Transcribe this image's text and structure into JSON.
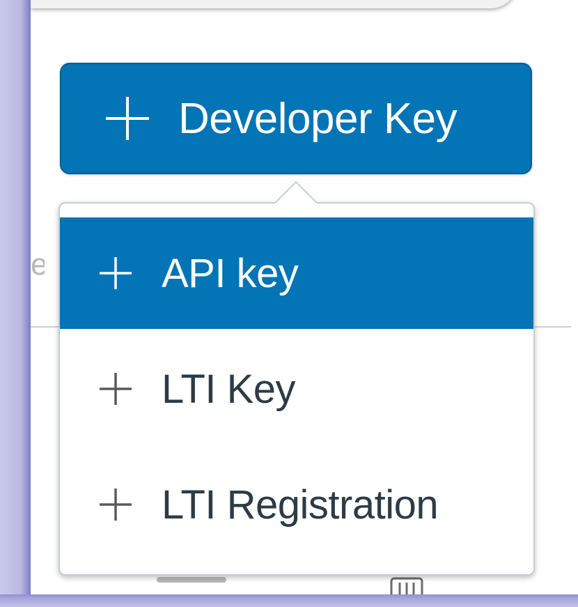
{
  "button": {
    "label": "Developer Key",
    "icon": "plus-icon",
    "color": "#0374b5"
  },
  "menu": {
    "items": [
      {
        "label": "API key",
        "icon": "plus-icon",
        "selected": true
      },
      {
        "label": "LTI Key",
        "icon": "plus-icon",
        "selected": false
      },
      {
        "label": "LTI Registration",
        "icon": "plus-icon",
        "selected": false
      }
    ],
    "highlight_color": "#0374b5",
    "text_color": "#2d3b45"
  }
}
